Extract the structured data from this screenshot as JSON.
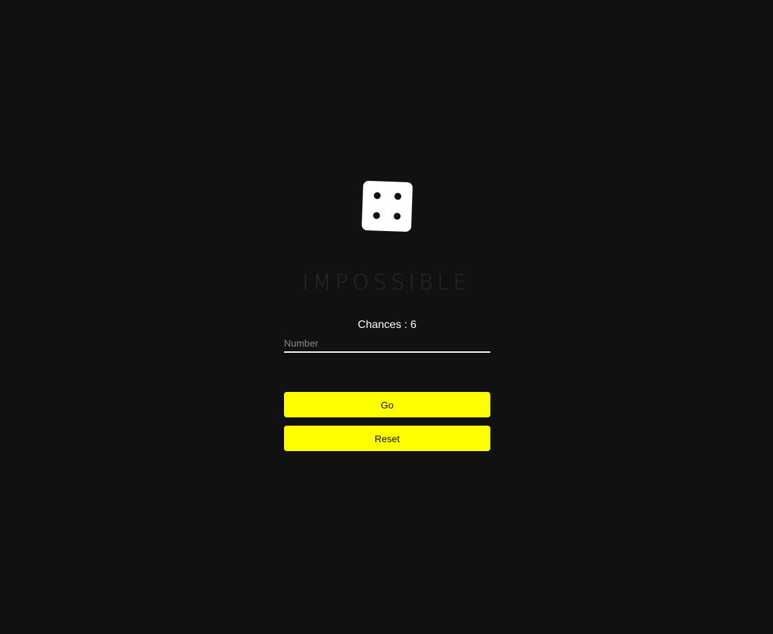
{
  "game": {
    "title": "IMPOSSIBLE",
    "dice_face_value": 4,
    "chances_label": "Chances : 6",
    "number_input": {
      "placeholder": "Number",
      "value": ""
    },
    "go_label": "Go",
    "reset_label": "Reset"
  },
  "colors": {
    "background": "#111111",
    "accent": "#ffff00",
    "title_text": "#2a2a2a",
    "text": "#ffffff"
  },
  "icons": {
    "dice": "dice-four-icon"
  }
}
